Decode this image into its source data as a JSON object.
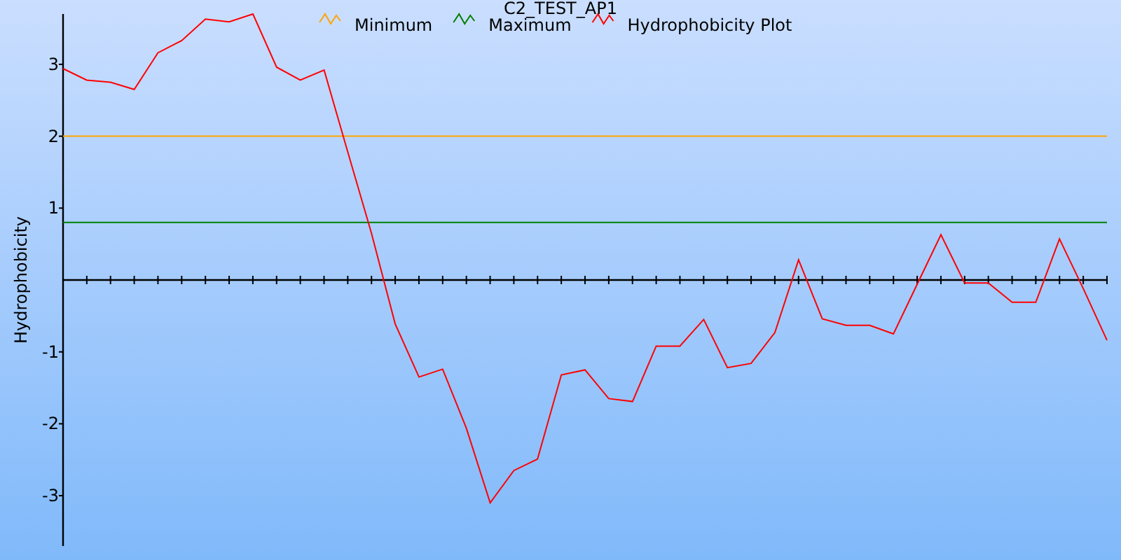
{
  "chart_data": {
    "type": "line",
    "title": "C2_TEST_AP1",
    "ylabel": "Hydrophobicity",
    "legend": true,
    "ylim": [
      -3.7,
      3.7
    ],
    "yticks": [
      -3,
      -2,
      -1,
      1,
      2,
      3
    ],
    "series": [
      {
        "name": "Minimum",
        "color": "#ffa500",
        "values": [
          2,
          2,
          2,
          2,
          2,
          2,
          2,
          2,
          2,
          2,
          2,
          2,
          2,
          2,
          2,
          2,
          2,
          2,
          2,
          2,
          2,
          2,
          2,
          2,
          2,
          2,
          2,
          2,
          2,
          2,
          2,
          2,
          2,
          2,
          2,
          2,
          2,
          2,
          2,
          2,
          2,
          2,
          2,
          2,
          2
        ]
      },
      {
        "name": "Maximum",
        "color": "#008000",
        "values": [
          0.8,
          0.8,
          0.8,
          0.8,
          0.8,
          0.8,
          0.8,
          0.8,
          0.8,
          0.8,
          0.8,
          0.8,
          0.8,
          0.8,
          0.8,
          0.8,
          0.8,
          0.8,
          0.8,
          0.8,
          0.8,
          0.8,
          0.8,
          0.8,
          0.8,
          0.8,
          0.8,
          0.8,
          0.8,
          0.8,
          0.8,
          0.8,
          0.8,
          0.8,
          0.8,
          0.8,
          0.8,
          0.8,
          0.8,
          0.8,
          0.8,
          0.8,
          0.8,
          0.8,
          0.8
        ]
      },
      {
        "name": "Hydrophobicity Plot",
        "color": "#ff0000",
        "values": [
          2.94,
          2.78,
          2.75,
          2.65,
          3.16,
          3.33,
          3.63,
          3.59,
          3.7,
          2.96,
          2.78,
          2.92,
          1.78,
          0.65,
          -0.61,
          -1.35,
          -1.24,
          -2.06,
          -3.1,
          -2.65,
          -2.49,
          -1.32,
          -1.25,
          -1.65,
          -1.69,
          -0.92,
          -0.92,
          -0.55,
          -1.22,
          -1.16,
          -0.73,
          0.28,
          -0.54,
          -0.63,
          -0.63,
          -0.75,
          -0.06,
          0.63,
          -0.04,
          -0.04,
          -0.31,
          -0.31,
          0.57,
          -0.12,
          -0.84
        ]
      }
    ]
  }
}
